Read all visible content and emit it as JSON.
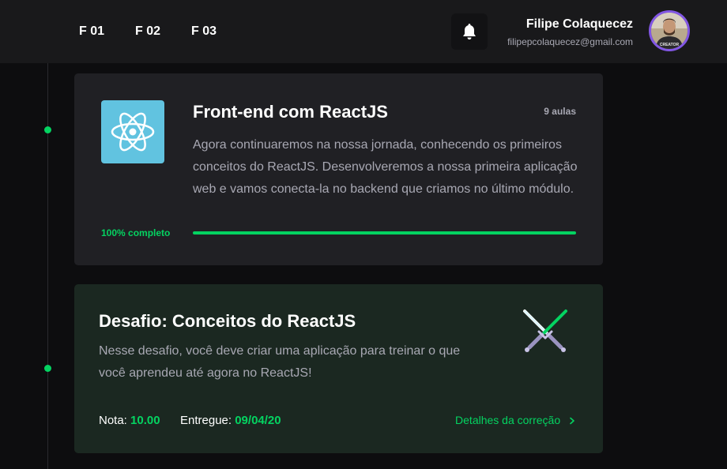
{
  "header": {
    "nav": [
      {
        "label": "F 01"
      },
      {
        "label": "F 02"
      },
      {
        "label": "F 03"
      }
    ],
    "notifications_icon": "bell-icon",
    "user": {
      "name": "Filipe Colaquecez",
      "email": "filipepcolaquecez@gmail.com",
      "avatar_shirt_text": "CREATOR"
    }
  },
  "module_card": {
    "title": "Front-end com ReactJS",
    "lessons": "9 aulas",
    "description": "Agora continuaremos na nossa jornada, conhecendo os primeiros conceitos do ReactJS. Desenvolveremos a nossa primeira aplicação web e vamos conecta-la no backend que criamos no último módulo.",
    "progress_label": "100% completo",
    "progress_value": 100,
    "icon": "react-icon"
  },
  "challenge_card": {
    "title": "Desafio: Conceitos do ReactJS",
    "description": "Nesse desafio, você deve criar uma aplicação para treinar o que você aprendeu até agora no ReactJS!",
    "grade_label": "Nota:",
    "grade_value": "10.00",
    "delivered_label": "Entregue:",
    "delivered_value": "09/04/20",
    "details_link": "Detalhes da correção",
    "details_icon": "chevron-right-icon",
    "icon": "crossed-swords-icon"
  },
  "colors": {
    "accent": "#04d361",
    "avatar_border": "#8257e5",
    "react_bg": "#61c3e0"
  }
}
